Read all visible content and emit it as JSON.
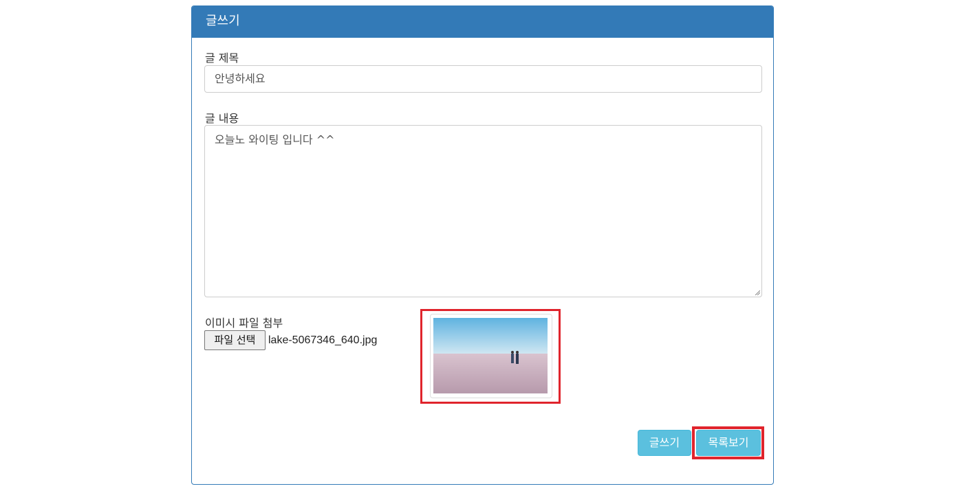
{
  "panel": {
    "heading": "글쓰기"
  },
  "form": {
    "title_label": "글 제목",
    "title_value": "안녕하세요",
    "content_label": "글 내용",
    "content_value": "오늘노 와이팅 입니다 ^^",
    "file_label": "이미시 파일 첨부",
    "file_button": "파일 선택",
    "file_name": "lake-5067346_640.jpg"
  },
  "buttons": {
    "write": "글쓰기",
    "list": "목록보기"
  },
  "colors": {
    "primary": "#337ab7",
    "info": "#5bc0de",
    "highlight": "#e0242c"
  }
}
